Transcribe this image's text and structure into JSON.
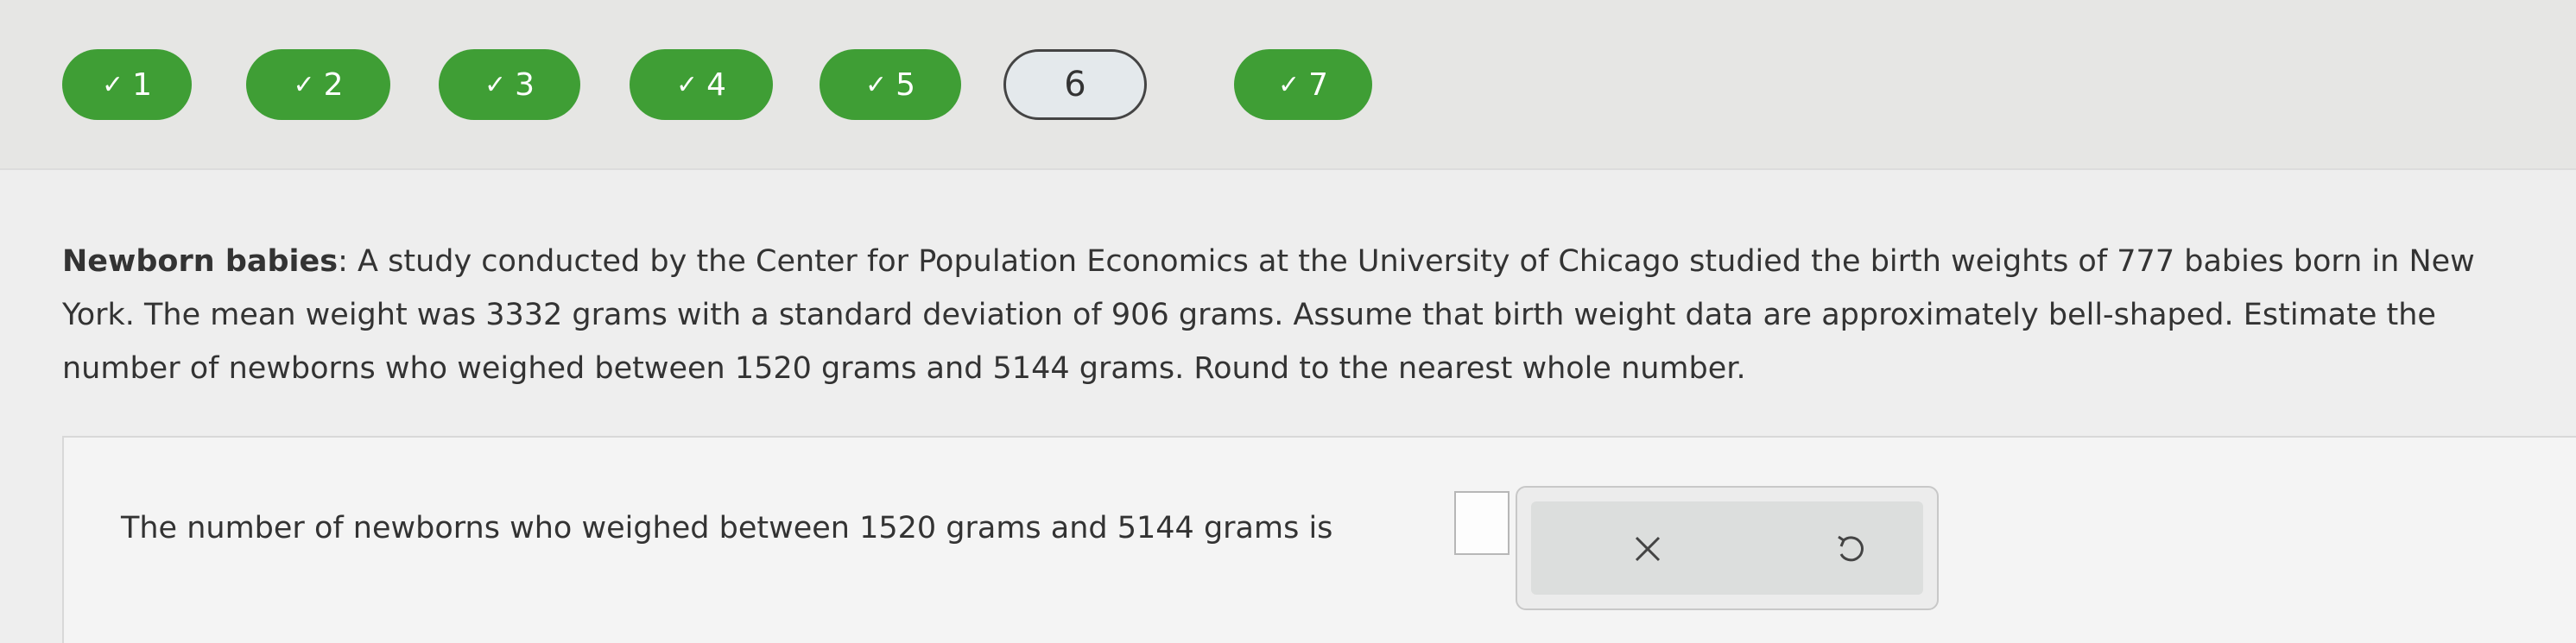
{
  "progress": {
    "items": [
      {
        "label": "1",
        "status": "done"
      },
      {
        "label": "2",
        "status": "done"
      },
      {
        "label": "3",
        "status": "done"
      },
      {
        "label": "4",
        "status": "done"
      },
      {
        "label": "5",
        "status": "done"
      },
      {
        "label": "6",
        "status": "current"
      },
      {
        "label": "7",
        "status": "done"
      }
    ],
    "check_glyph": "✓",
    "done_color": "#3f9e35"
  },
  "question": {
    "topic": "Newborn babies",
    "separator": ":",
    "body": " A study conducted by the Center for Population Economics at the University of Chicago studied the birth weights of 777 babies born in New York. The mean weight was 3332 grams with a standard deviation of 906 grams. Assume that birth weight data are approximately bell-shaped. Estimate the number of newborns who weighed between 1520 grams and 5144 grams. Round to the nearest whole number."
  },
  "answer": {
    "prompt": "The number of newborns who weighed between 1520 grams and 5144 grams is",
    "value": "",
    "end": "."
  },
  "actions": {
    "clear_icon": "close-icon",
    "reset_icon": "undo-icon"
  }
}
